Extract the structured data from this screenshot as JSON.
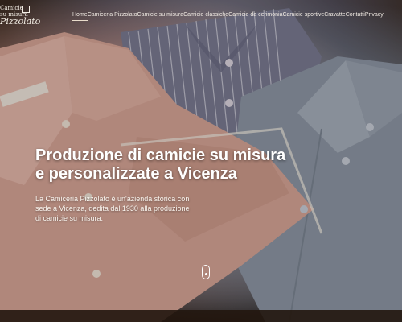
{
  "logo": {
    "line1": "Camicie",
    "line2": "su misura",
    "line3": "Pizzolato"
  },
  "nav": {
    "items": [
      "Home",
      "Camiceria Pizzolato",
      "Camicie su misura",
      "Camicie classiche",
      "Camicie da cerimonia",
      "Camicie sportive",
      "Cravatte",
      "Contatti",
      "Privacy"
    ],
    "active": "Home"
  },
  "hero": {
    "headline_line1": "Produzione di camicie su misura",
    "headline_line2": "e personalizzate a Vicenza",
    "subtext": "La Camiceria Pizzolato è un'azienda storica con sede a Vicenza, dedita dal 1930 alla produzione di camicie su misura.",
    "scroll_icon": "mouse-scroll-icon"
  },
  "colors": {
    "nav_text": "#f2ece4",
    "headline": "#ffffff",
    "pink_shirt": "#d9a79b",
    "grey_shirt": "#8f98a6",
    "striped_shirt": "#6e6f86",
    "table_wood": "#2a1e16"
  }
}
